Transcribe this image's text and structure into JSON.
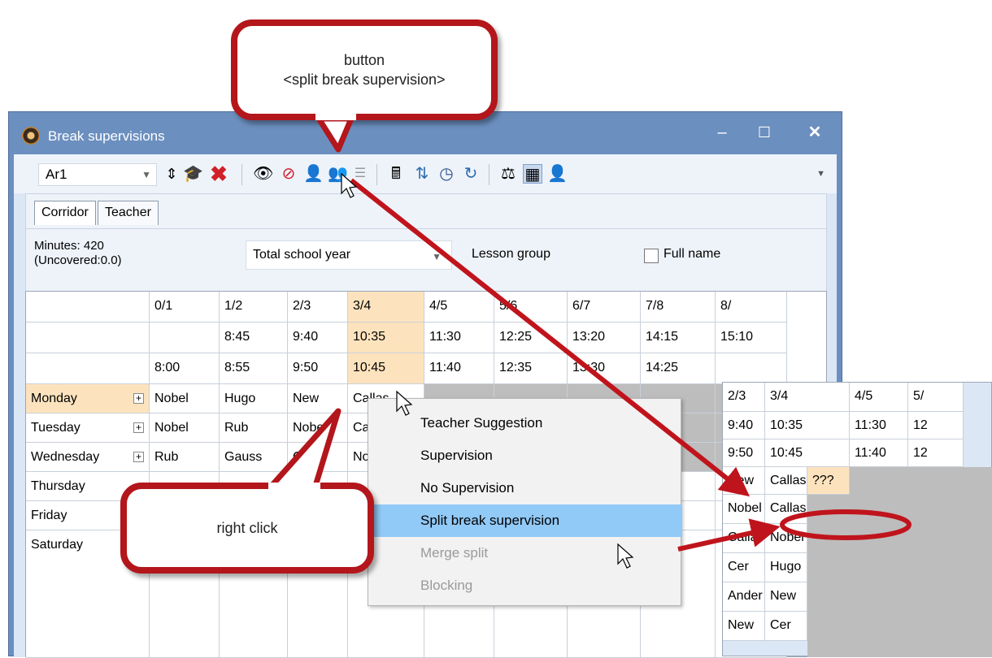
{
  "window": {
    "title": "Break supervisions",
    "controls": {
      "minimize": "–",
      "maximize": "☐",
      "close": "✕"
    }
  },
  "toolbar": {
    "element_value": "Ar1",
    "icons": [
      "stepper-icon",
      "mortarboard-icon",
      "delete-icon",
      "eye-icon",
      "eye-off-icon",
      "split-supervision-icon",
      "merge-supervision-icon",
      "assign-icon",
      "calculator-icon",
      "transfer-icon",
      "clock-icon",
      "refresh-icon",
      "balance-icon",
      "view-icon",
      "teacher-icon"
    ]
  },
  "tabs": [
    {
      "label": "Corridor",
      "active": true
    },
    {
      "label": "Teacher",
      "active": false
    }
  ],
  "filter": {
    "minutes_line1": "Minutes: 420",
    "minutes_line2": "(Uncovered:0.0)",
    "period_value": "Total school year",
    "lesson_group_label": "Lesson group",
    "full_name_label": "Full name",
    "full_name_checked": false
  },
  "grid": {
    "columns": [
      {
        "break": "0/1",
        "start": "",
        "end": "8:00"
      },
      {
        "break": "1/2",
        "start": "8:45",
        "end": "8:55"
      },
      {
        "break": "2/3",
        "start": "9:40",
        "end": "9:50"
      },
      {
        "break": "3/4",
        "start": "10:35",
        "end": "10:45"
      },
      {
        "break": "4/5",
        "start": "11:30",
        "end": "11:40"
      },
      {
        "break": "5/6",
        "start": "12:25",
        "end": "12:35"
      },
      {
        "break": "6/7",
        "start": "13:20",
        "end": "13:30"
      },
      {
        "break": "7/8",
        "start": "14:15",
        "end": "14:25"
      },
      {
        "break": "8/",
        "start": "15:10",
        "end": ""
      }
    ],
    "rows": [
      {
        "day": "Monday",
        "cells": [
          "Nobel",
          "Hugo",
          "New",
          "Callas"
        ]
      },
      {
        "day": "Tuesday",
        "cells": [
          "Nobel",
          "Rub",
          "Nobel",
          "Ca"
        ]
      },
      {
        "day": "Wednesday",
        "cells": [
          "Rub",
          "Gauss",
          "Ca",
          "No"
        ]
      },
      {
        "day": "Thursday",
        "cells": []
      },
      {
        "day": "Friday",
        "cells": []
      },
      {
        "day": "Saturday",
        "cells": []
      }
    ]
  },
  "context_menu": {
    "items": [
      {
        "label": "Teacher Suggestion",
        "state": "normal"
      },
      {
        "label": "Supervision",
        "state": "normal"
      },
      {
        "label": "No Supervision",
        "state": "normal"
      },
      {
        "label": "Split break supervision",
        "state": "selected"
      },
      {
        "label": "Merge split",
        "state": "disabled"
      },
      {
        "label": "Blocking",
        "state": "disabled"
      }
    ]
  },
  "inset": {
    "headers": [
      "2/3",
      "3/4",
      "",
      "4/5",
      "5/"
    ],
    "start_times": [
      "9:40",
      "10:35",
      "",
      "11:30",
      "12"
    ],
    "end_times": [
      "9:50",
      "10:45",
      "",
      "11:40",
      "12"
    ],
    "rows": [
      [
        "New",
        "Callas",
        "???"
      ],
      [
        "Nobel",
        "Callas"
      ],
      [
        "Callas",
        "Nobel"
      ],
      [
        "Cer",
        "Hugo"
      ],
      [
        "Ander",
        "New"
      ],
      [
        "New",
        "Cer"
      ]
    ]
  },
  "callouts": {
    "button_line1": "button",
    "button_line2": "<split break supervision>",
    "right_click": "right click"
  },
  "colors": {
    "titlebar": "#6b8fbf",
    "highlight": "#fde3bd",
    "menu_selected": "#91c9f7",
    "callout_border": "#b3161b",
    "blocked_cell": "#bdbdbd"
  }
}
